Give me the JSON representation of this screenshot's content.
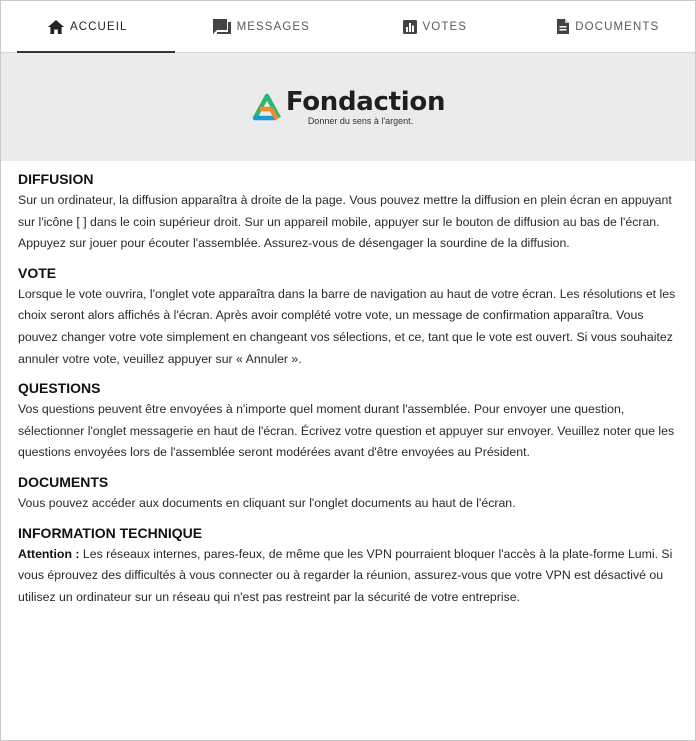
{
  "tabs": [
    {
      "label": "ACCUEIL",
      "icon": "home-icon",
      "active": true
    },
    {
      "label": "MESSAGES",
      "icon": "chat-icon",
      "active": false
    },
    {
      "label": "VOTES",
      "icon": "bar-chart-icon",
      "active": false
    },
    {
      "label": "DOCUMENTS",
      "icon": "document-icon",
      "active": false
    }
  ],
  "logo": {
    "name": "Fondaction",
    "tagline": "Donner du sens à l'argent.",
    "colors": {
      "orange": "#f28c28",
      "green": "#2bb673",
      "blue": "#1c9ad6"
    }
  },
  "sections": [
    {
      "heading": "DIFFUSION",
      "body": "Sur un ordinateur, la diffusion apparaîtra à droite de la page. Vous pouvez mettre la diffusion en plein écran en appuyant sur l'icône [ ] dans le coin supérieur droit. Sur un appareil mobile, appuyer sur le bouton de diffusion au bas de l'écran. Appuyez sur jouer pour écouter l'assemblée. Assurez-vous de désengager la sourdine de la diffusion."
    },
    {
      "heading": "VOTE",
      "body": "Lorsque le vote ouvrira, l'onglet vote apparaîtra dans la barre de navigation au haut de votre écran. Les résolutions et les choix seront alors affichés à l'écran. Après avoir complété votre vote, un message de confirmation apparaîtra. Vous pouvez changer votre vote simplement en changeant vos sélections, et ce, tant que le vote est ouvert. Si vous souhaitez annuler votre vote, veuillez appuyer sur « Annuler »."
    },
    {
      "heading": "QUESTIONS",
      "body": "Vos questions peuvent être envoyées à n'importe quel moment durant l'assemblée. Pour envoyer une question, sélectionner l'onglet messagerie en haut de l'écran. Écrivez votre question et appuyer sur envoyer. Veuillez noter que les questions envoyées lors de l'assemblée seront modérées avant d'être envoyées au Président."
    },
    {
      "heading": "DOCUMENTS",
      "body": "Vous pouvez accéder aux documents en cliquant sur l'onglet documents au haut de l'écran."
    },
    {
      "heading": "INFORMATION TECHNIQUE",
      "lead": "Attention :",
      "body": " Les réseaux internes, pares-feux, de même que les VPN pourraient bloquer l'accès à la plate-forme Lumi. Si vous éprouvez des difficultés à vous connecter ou à regarder la réunion, assurez-vous que votre VPN est désactivé ou utilisez un ordinateur sur un réseau qui n'est pas restreint par la sécurité de votre entreprise."
    }
  ]
}
